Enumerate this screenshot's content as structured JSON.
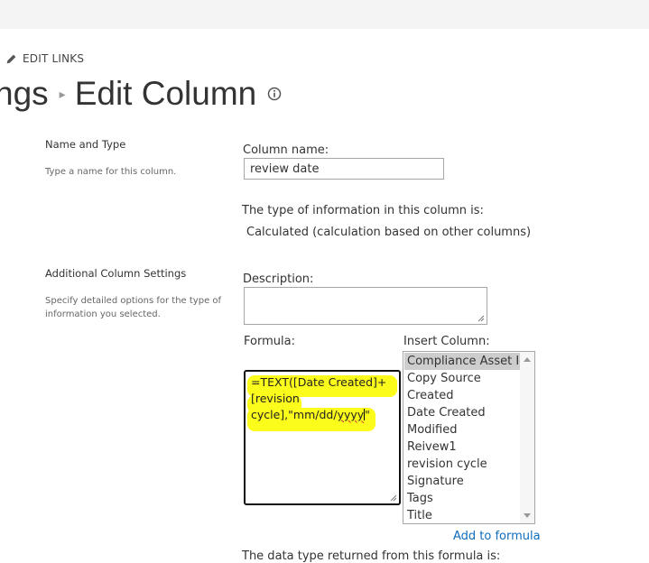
{
  "header": {
    "edit_links_label": "EDIT LINKS",
    "breadcrumb_parent": "ngs",
    "title": "Edit Column"
  },
  "name_type": {
    "section_title": "Name and Type",
    "section_desc": "Type a name for this column.",
    "column_name_label": "Column name:",
    "column_name_value": "review date",
    "type_info_label": "The type of information in this column is:",
    "type_value": "Calculated (calculation based on other columns)"
  },
  "additional": {
    "section_title": "Additional Column Settings",
    "section_desc": "Specify detailed options for the type of information you selected.",
    "description_label": "Description:",
    "description_value": "",
    "formula_label": "Formula:",
    "formula_line1": "=TEXT([Date Created]+",
    "formula_line2": "[revision",
    "formula_line3_a": "cycle],\"mm/dd/",
    "formula_line3_b": "yyyy",
    "formula_line3_c": "\"",
    "insert_column_label": "Insert Column:",
    "insert_columns": [
      "Compliance Asset Id",
      "Copy Source",
      "Created",
      "Date Created",
      "Modified",
      "Reivew1",
      "revision cycle",
      "Signature",
      "Tags",
      "Title"
    ],
    "add_to_formula_label": "Add to formula",
    "return_type_label": "The data type returned from this formula is:"
  },
  "colors": {
    "highlight": "#fcfc1c",
    "link": "#0f6cbd",
    "selected_item": "#cdcdcd"
  }
}
